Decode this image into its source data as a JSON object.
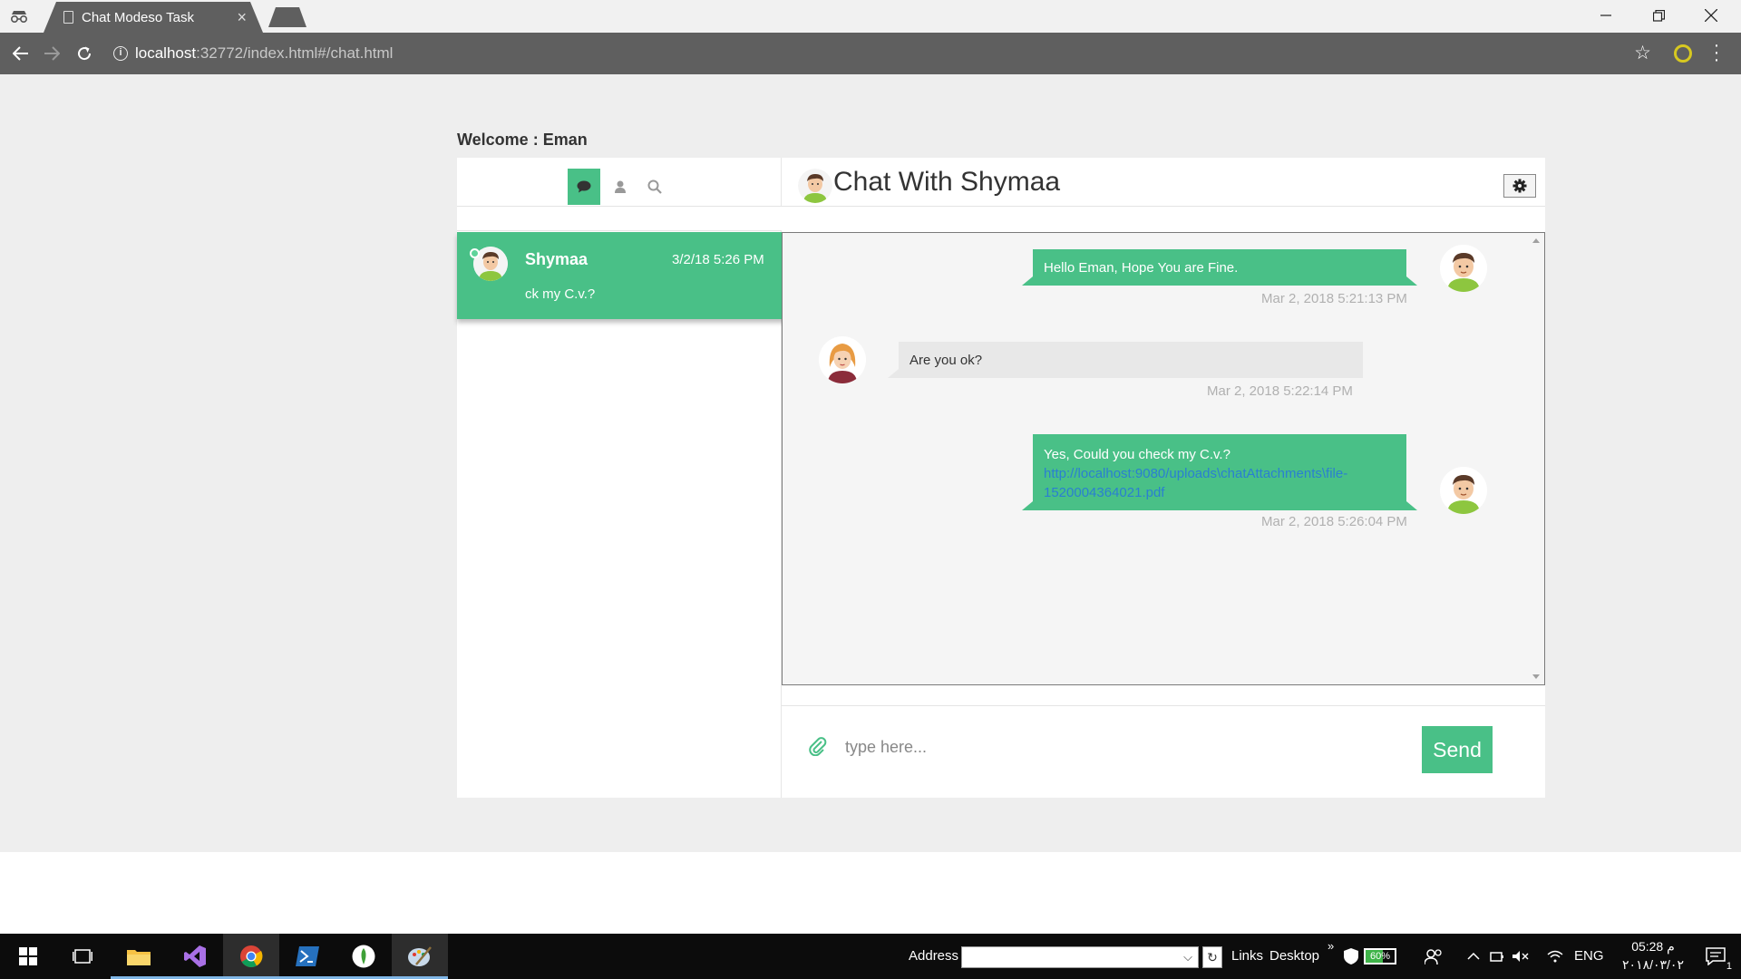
{
  "browser": {
    "tab_title": "Chat Modeso Task",
    "tab_close": "×",
    "url_host": "localhost",
    "url_rest": ":32772/index.html#/chat.html"
  },
  "app": {
    "welcome_label": "Welcome :",
    "welcome_name": "Eman",
    "left_tabs": [
      "chats-icon",
      "contacts-icon",
      "search-icon"
    ],
    "contacts": [
      {
        "name": "Shymaa",
        "date": "3/2/18 5:26 PM",
        "preview": "ck my C.v.?",
        "online": true
      }
    ],
    "chat": {
      "title": "Chat With Shymaa",
      "messages": [
        {
          "direction": "out",
          "text": "Hello Eman, Hope You are Fine.",
          "time": "Mar 2, 2018 5:21:13 PM"
        },
        {
          "direction": "in",
          "text": "Are you ok?",
          "time": "Mar 2, 2018 5:22:14 PM"
        },
        {
          "direction": "out",
          "text": "Yes, Could you check my C.v.?",
          "link_line1": "http://localhost:9080/uploads\\chatAttachments\\file-",
          "link_line2": "1520004364021.pdf",
          "time": "Mar 2, 2018 5:26:04 PM"
        }
      ],
      "input_placeholder": "type here...",
      "send_label": "Send"
    },
    "colors": {
      "accent": "#49c087",
      "incoming_bubble": "#e8e8e8",
      "link": "#2a7fd1"
    }
  },
  "taskbar": {
    "address_label": "Address",
    "links_label": "Links",
    "desktop_label": "Desktop",
    "battery": "60%",
    "battery_level_pct": 60,
    "language": "ENG",
    "time": "05:28 م",
    "date": "٢٠١٨/٠٣/٠٢",
    "notification_count": "1"
  }
}
